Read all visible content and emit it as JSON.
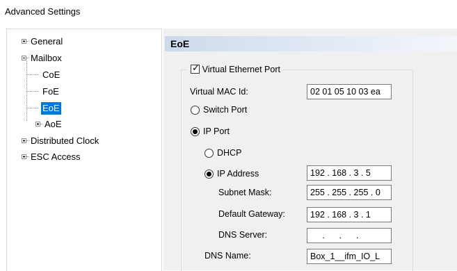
{
  "window": {
    "title": "Advanced Settings"
  },
  "tree": {
    "general": "General",
    "mailbox": "Mailbox",
    "coe": "CoE",
    "foe": "FoE",
    "eoe": "EoE",
    "aoe": "AoE",
    "distributed_clock": "Distributed Clock",
    "esc_access": "ESC Access",
    "selected": "EoE"
  },
  "panel": {
    "header": "EoE",
    "virtual_ethernet_port": {
      "label": "Virtual Ethernet Port",
      "checked": true
    },
    "virtual_mac": {
      "label": "Virtual MAC Id:",
      "value": "02 01 05 10 03 ea"
    },
    "switch_port": {
      "label": "Switch Port",
      "selected": false
    },
    "ip_port": {
      "label": "IP Port",
      "selected": true
    },
    "dhcp": {
      "label": "DHCP",
      "selected": false
    },
    "ip_address": {
      "label": "IP Address",
      "selected": true,
      "value": "192 . 168 .  3  .  5"
    },
    "subnet_mask": {
      "label": "Subnet Mask:",
      "value": "255 . 255 . 255 .  0"
    },
    "default_gateway": {
      "label": "Default Gateway:",
      "value": "192 . 168 .  3  .  1"
    },
    "dns_server": {
      "label": "DNS Server:",
      "value": "     .      .      .     "
    },
    "dns_name": {
      "label": "DNS Name:",
      "value": "Box_1__ifm_IO_L"
    }
  }
}
